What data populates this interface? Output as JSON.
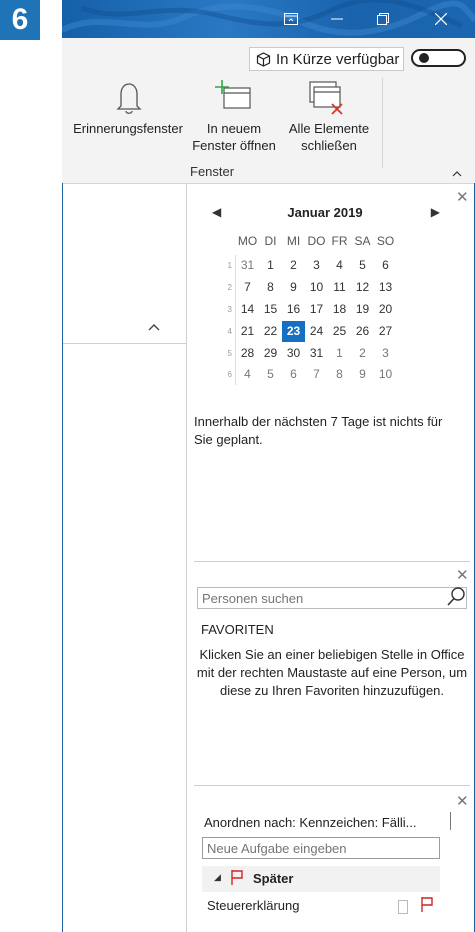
{
  "step_badge": "6",
  "title_bar": {
    "buttons": [
      {
        "name": "ribbon-display-icon",
        "glyph": "⊡"
      },
      {
        "name": "minimize-icon",
        "glyph": "—"
      },
      {
        "name": "restore-icon",
        "glyph": "❐"
      },
      {
        "name": "close-icon",
        "glyph": "✕"
      }
    ],
    "color": "#1a66b0"
  },
  "ribbon": {
    "coming_soon_label": "In Kürze verfügbar",
    "coming_soon_icon": "box-icon",
    "commands": [
      {
        "id": "reminders",
        "lines": [
          "Erinnerungsfenster"
        ],
        "icon": "bell-icon"
      },
      {
        "id": "new-window",
        "lines": [
          "In neuem",
          "Fenster öffnen"
        ],
        "icon": "new-window-icon"
      },
      {
        "id": "close-all",
        "lines": [
          "Alle Elemente",
          "schließen"
        ],
        "icon": "close-all-windows-icon"
      }
    ],
    "group_label": "Fenster"
  },
  "calendar": {
    "month_title": "Januar 2019",
    "weekday_headers": [
      "MO",
      "DI",
      "MI",
      "DO",
      "FR",
      "SA",
      "SO"
    ],
    "weeks": [
      {
        "wk": "1",
        "days": [
          "31",
          "1",
          "2",
          "3",
          "4",
          "5",
          "6"
        ]
      },
      {
        "wk": "2",
        "days": [
          "7",
          "8",
          "9",
          "10",
          "11",
          "12",
          "13"
        ]
      },
      {
        "wk": "3",
        "days": [
          "14",
          "15",
          "16",
          "17",
          "18",
          "19",
          "20"
        ]
      },
      {
        "wk": "4",
        "days": [
          "21",
          "22",
          "23",
          "24",
          "25",
          "26",
          "27"
        ]
      },
      {
        "wk": "5",
        "days": [
          "28",
          "29",
          "30",
          "31",
          "1",
          "2",
          "3"
        ]
      },
      {
        "wk": "6",
        "days": [
          "4",
          "5",
          "6",
          "7",
          "8",
          "9",
          "10"
        ]
      }
    ],
    "today": "23",
    "today_color": "#1570c4",
    "empty_note": "Innerhalb der nächsten 7 Tage ist nichts für Sie geplant."
  },
  "people": {
    "search_placeholder": "Personen suchen",
    "favorites_heading": "FAVORITEN",
    "favorites_hint": "Klicken Sie an einer beliebigen Stelle in Office mit der rechten Maustaste auf eine Person, um diese zu Ihren Favoriten hinzuzufügen."
  },
  "tasks": {
    "sort_label": "Anordnen nach: Kennzeichen: Fälli...",
    "new_task_placeholder": "Neue Aufgabe eingeben",
    "group_label": "Später",
    "items": [
      {
        "name": "Steuererklärung",
        "flag_color": "#d42424"
      }
    ]
  }
}
